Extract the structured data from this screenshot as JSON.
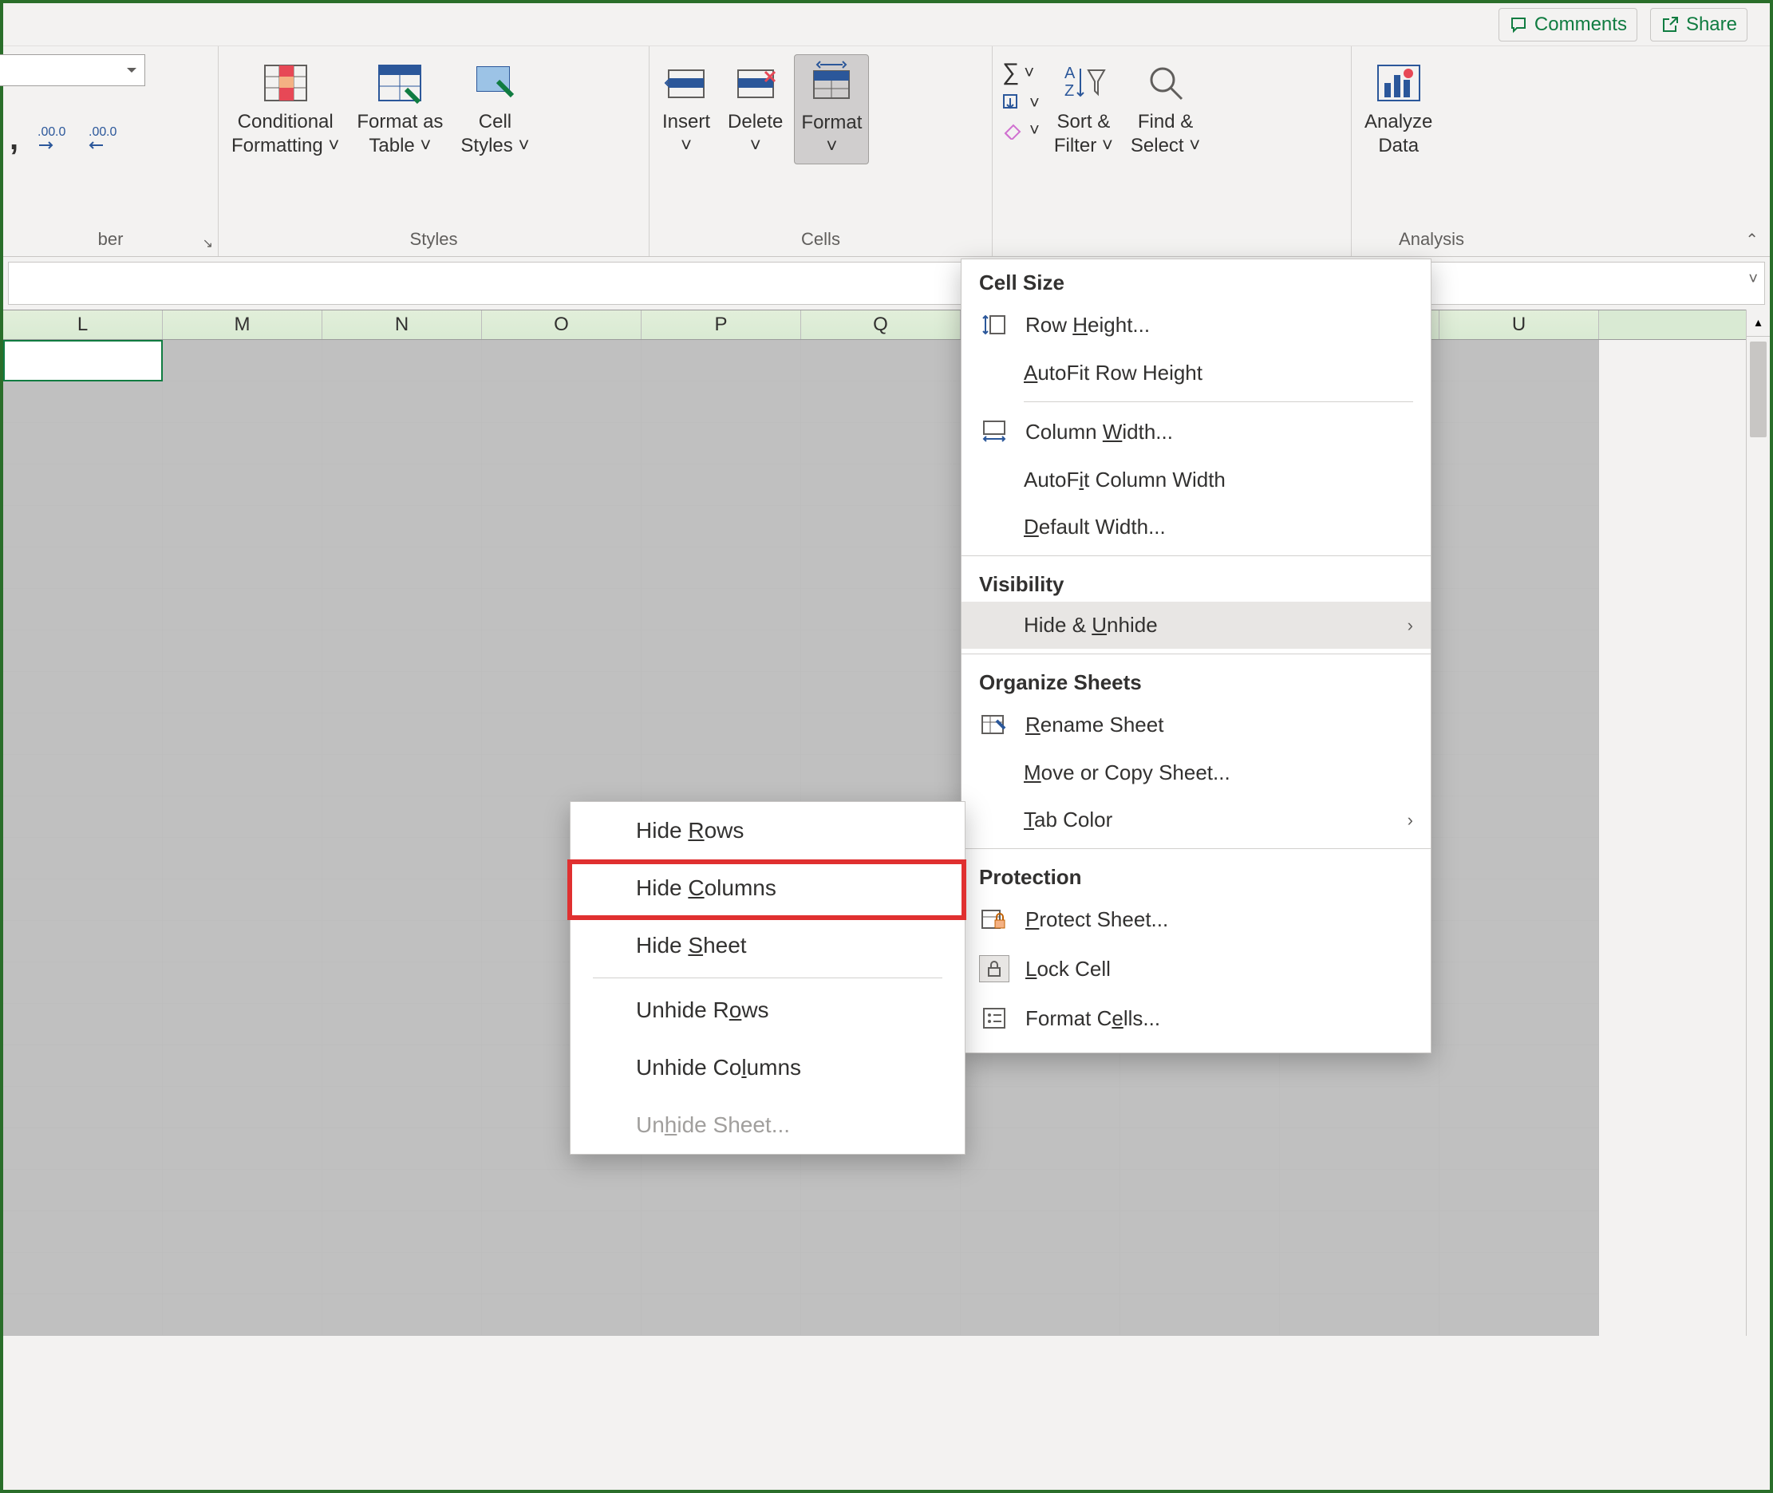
{
  "topbar": {
    "comments": "Comments",
    "share": "Share"
  },
  "ribbon": {
    "number_group": "ber",
    "styles": {
      "label": "Styles",
      "conditional_formatting": "Conditional\nFormatting",
      "format_as_table": "Format as\nTable",
      "cell_styles": "Cell\nStyles"
    },
    "cells": {
      "label": "Cells",
      "insert": "Insert",
      "delete": "Delete",
      "format": "Format"
    },
    "editing": {
      "sort_filter": "Sort &\nFilter",
      "find_select": "Find &\nSelect"
    },
    "analysis": {
      "label": "Analysis",
      "analyze_data": "Analyze\nData"
    }
  },
  "columns": [
    "L",
    "M",
    "N",
    "O",
    "P",
    "Q",
    "",
    "",
    "",
    "U"
  ],
  "format_menu": {
    "cell_size": "Cell Size",
    "row_height": "Row Height...",
    "autofit_row": "AutoFit Row Height",
    "column_width": "Column Width...",
    "autofit_col": "AutoFit Column Width",
    "default_width": "Default Width...",
    "visibility": "Visibility",
    "hide_unhide": "Hide & Unhide",
    "organize": "Organize Sheets",
    "rename": "Rename Sheet",
    "move_copy": "Move or Copy Sheet...",
    "tab_color": "Tab Color",
    "protection": "Protection",
    "protect_sheet": "Protect Sheet...",
    "lock_cell": "Lock Cell",
    "format_cells": "Format Cells..."
  },
  "hide_submenu": {
    "hide_rows": "Hide Rows",
    "hide_cols": "Hide Columns",
    "hide_sheet": "Hide Sheet",
    "unhide_rows": "Unhide Rows",
    "unhide_cols": "Unhide Columns",
    "unhide_sheet": "Unhide Sheet..."
  }
}
